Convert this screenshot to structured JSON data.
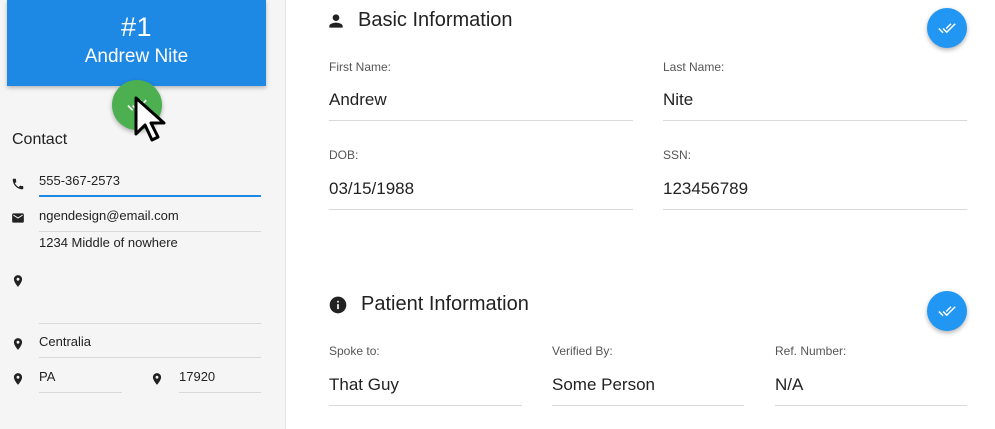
{
  "header": {
    "number": "#1",
    "name": "Andrew Nite"
  },
  "sidebar": {
    "title": "Contact",
    "phone": "555-367-2573",
    "email": "ngendesign@email.com",
    "address": "1234 Middle of nowhere",
    "city": "Centralia",
    "state": "PA",
    "zip": "17920"
  },
  "basic": {
    "title": "Basic Information",
    "first_name_label": "First Name:",
    "first_name": "Andrew",
    "last_name_label": "Last Name:",
    "last_name": "Nite",
    "dob_label": "DOB:",
    "dob": "03/15/1988",
    "ssn_label": "SSN:",
    "ssn": "123456789"
  },
  "patient": {
    "title": "Patient Information",
    "spoke_label": "Spoke to:",
    "spoke": "That Guy",
    "verified_label": "Verified By:",
    "verified": "Some Person",
    "ref_label": "Ref. Number:",
    "ref": "N/A"
  },
  "colors": {
    "header_blue": "#1e88e5",
    "fab_green": "#4caf50",
    "fab_blue": "#2196f3"
  },
  "icons": [
    "phone-icon",
    "email-icon",
    "location-icon",
    "person-icon",
    "info-icon",
    "done-all-icon"
  ]
}
